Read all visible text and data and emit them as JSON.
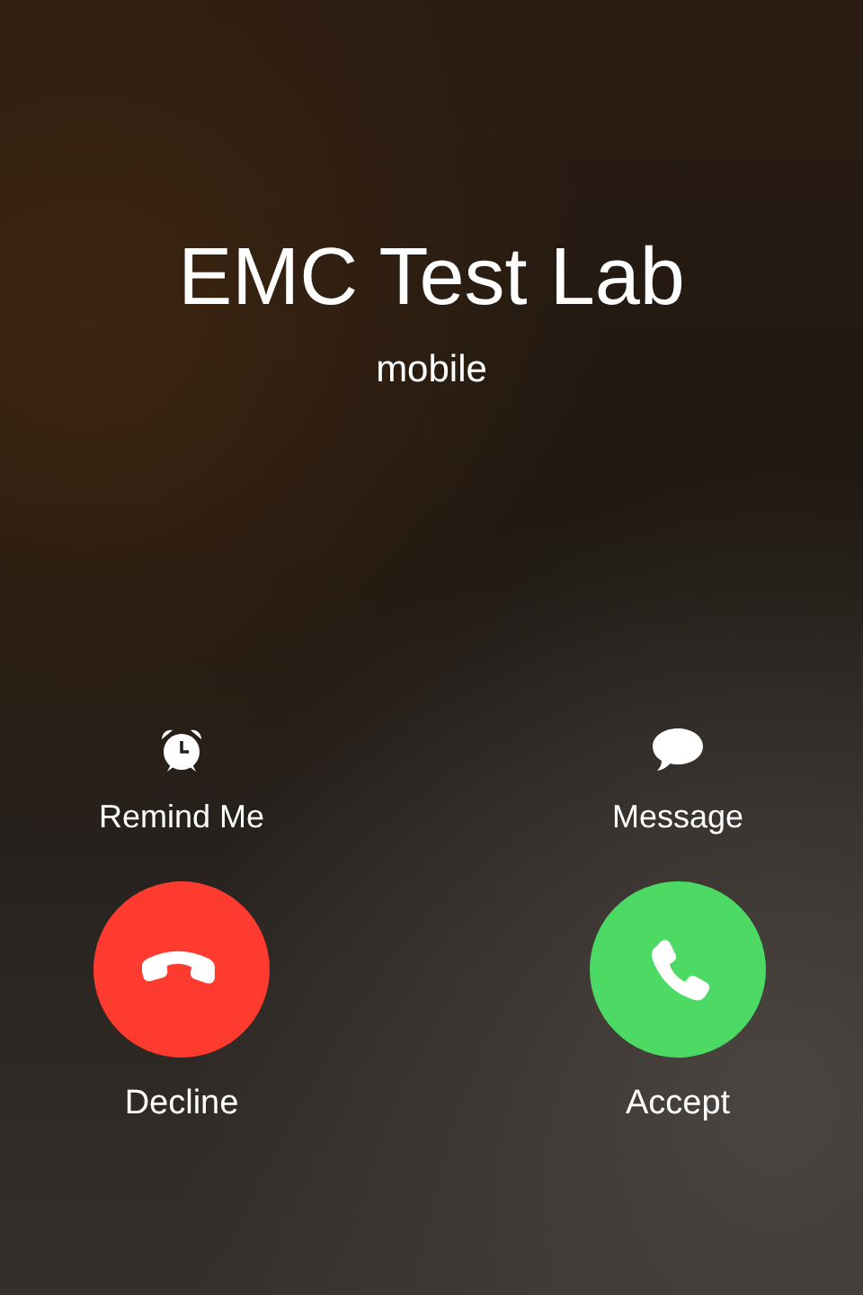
{
  "caller": {
    "name": "EMC Test Lab",
    "subtitle": "mobile"
  },
  "actions": [
    {
      "kind": "remind",
      "label": "Remind Me"
    },
    {
      "kind": "message",
      "label": "Message"
    }
  ],
  "buttons": [
    {
      "kind": "decline",
      "label": "Decline"
    },
    {
      "kind": "accept",
      "label": "Accept"
    }
  ]
}
